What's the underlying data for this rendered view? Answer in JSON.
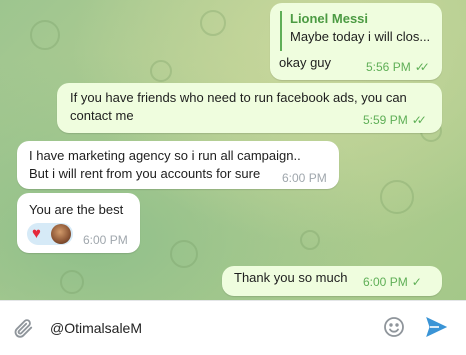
{
  "messages": [
    {
      "direction": "outgoing",
      "reply": {
        "author": "Lionel Messi",
        "text": "Maybe today i will clos..."
      },
      "lines": [
        "okay guy"
      ],
      "time": "5:56 PM",
      "status": "read"
    },
    {
      "direction": "outgoing",
      "lines": [
        "If you have friends who need to run facebook ads, you can",
        "contact me"
      ],
      "time": "5:59 PM",
      "status": "read"
    },
    {
      "direction": "incoming",
      "lines": [
        "I have marketing agency so i run all campaign..",
        "But i will rent from you accounts for sure"
      ],
      "time": "6:00 PM"
    },
    {
      "direction": "incoming",
      "lines": [
        "You are the best"
      ],
      "reactions": [
        "heart",
        "avatar"
      ],
      "time": "6:00 PM"
    },
    {
      "direction": "outgoing",
      "lines": [
        "Thank you so much"
      ],
      "time": "6:00 PM",
      "status": "sent"
    }
  ],
  "composer": {
    "text": "@OtimalsaleM"
  },
  "icons": {
    "attach": "paperclip-icon",
    "emoji": "smile-icon",
    "send": "send-icon",
    "read": "double-check-icon",
    "sent": "check-icon",
    "reaction": "heart-icon"
  },
  "colors": {
    "outgoing_bubble": "#effdde",
    "incoming_bubble": "#ffffff",
    "accent_green": "#5faf57",
    "send_blue": "#3a94d6"
  }
}
